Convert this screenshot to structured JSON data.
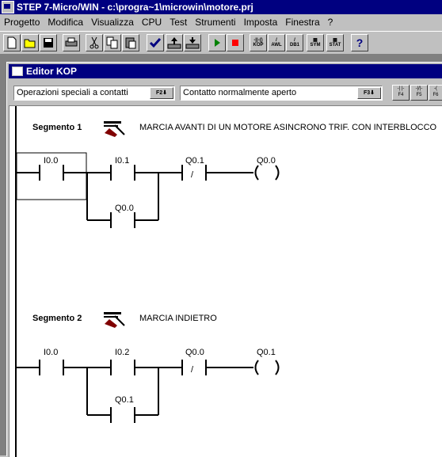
{
  "app": {
    "title": "STEP 7-Micro/WIN - c:\\progra~1\\microwin\\motore.prj"
  },
  "menu": [
    "Progetto",
    "Modifica",
    "Visualizza",
    "CPU",
    "Test",
    "Strumenti",
    "Imposta",
    "Finestra",
    "?"
  ],
  "toolbar": {
    "kop_label": "KOP",
    "awl_label": "AWL",
    "db1_label": "DB1",
    "sym_label": "SYM",
    "stat_label": "STAT",
    "help_label": "?"
  },
  "editor": {
    "title": "Editor KOP",
    "instr_group": "Operazioni speciali a contatti",
    "instr_group_key": "F2",
    "instruction": "Contatto normalmente aperto",
    "instruction_key": "F3",
    "fkeys": [
      "F4",
      "F5",
      "F6"
    ]
  },
  "segments": [
    {
      "label": "Segmento 1",
      "comment": "MARCIA AVANTI DI UN MOTORE ASINCRONO TRIF. CON INTERBLOCCO",
      "contacts": [
        "I0.0",
        "I0.1",
        "Q0.1",
        "Q0.0"
      ],
      "coil": "Q0.0"
    },
    {
      "label": "Segmento 2",
      "comment": "MARCIA INDIETRO",
      "contacts": [
        "I0.0",
        "I0.2",
        "Q0.0",
        "Q0.1"
      ],
      "coil": "Q0.1"
    }
  ]
}
